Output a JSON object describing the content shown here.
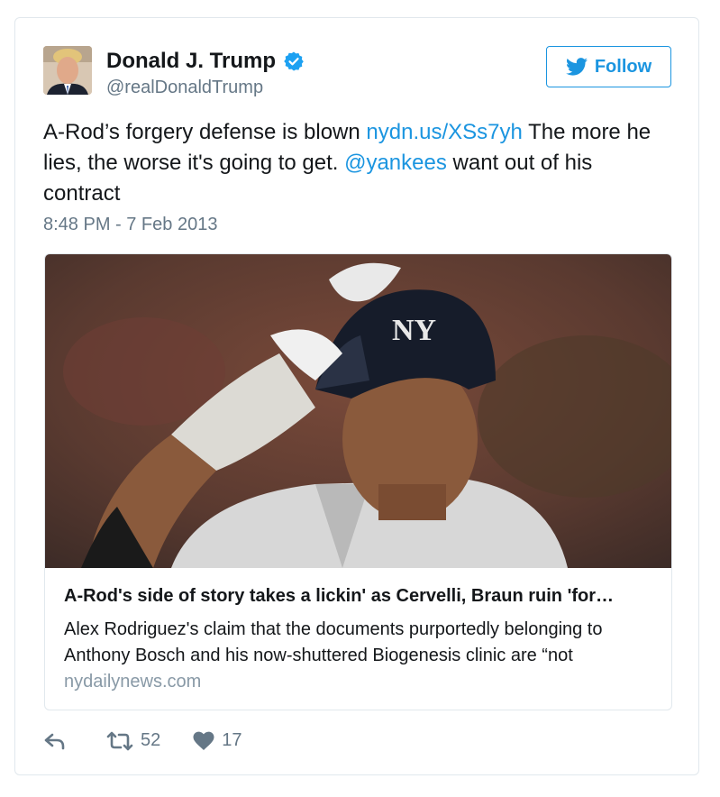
{
  "tweet": {
    "author_name": "Donald J. Trump",
    "handle": "@realDonaldTrump",
    "follow_label": "Follow",
    "text_part1": "A-Rod’s forgery defense is blown ",
    "link": "nydn.us/XSs7yh",
    "text_part2": " The more he lies, the worse it's going to get. ",
    "mention": "@yankees",
    "text_part3": " want out of his contract",
    "timestamp": "8:48 PM - 7 Feb 2013",
    "retweet_count": "52",
    "like_count": "17"
  },
  "link_card": {
    "title": "A-Rod's side of story takes a lickin' as Cervelli, Braun ruin 'for…",
    "description": "Alex Rodriguez's claim that the documents purportedly belonging to Anthony Bosch and his now-shuttered Biogenesis clinic are “not",
    "domain": "nydailynews.com"
  },
  "colors": {
    "accent": "#1b95e0",
    "secondary_text": "#657786",
    "border": "#e1e8ed"
  },
  "icons": [
    "verified-badge-icon",
    "twitter-bird-icon",
    "reply-icon",
    "retweet-icon",
    "heart-icon"
  ]
}
